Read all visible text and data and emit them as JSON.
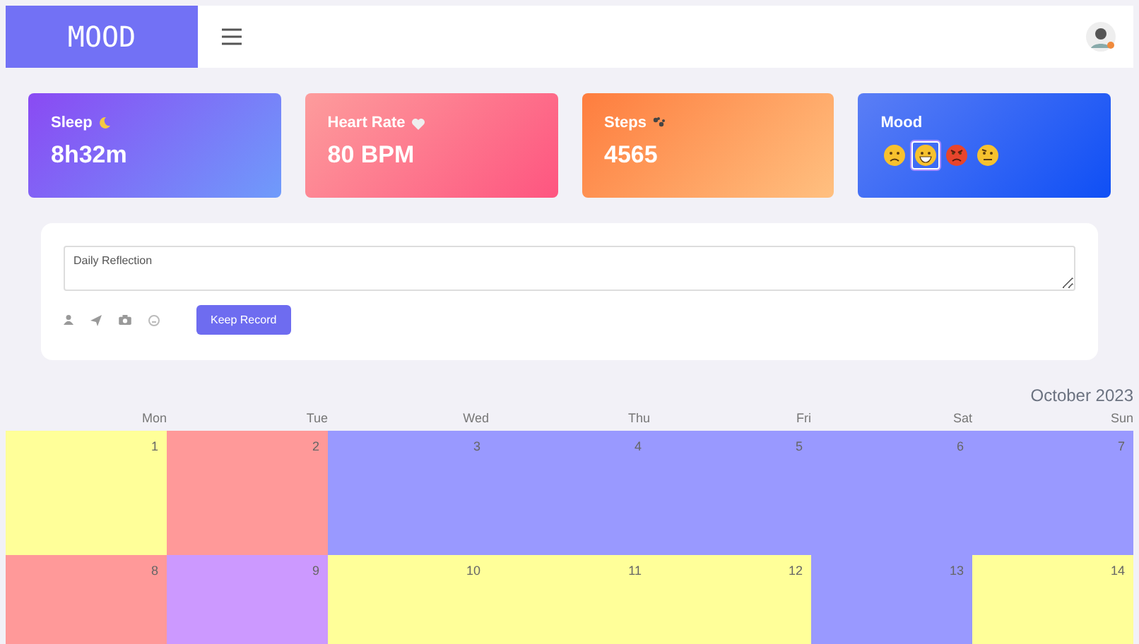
{
  "header": {
    "logo": "MOOD"
  },
  "stats": [
    {
      "kind": "sleep",
      "label": "Sleep",
      "value": "8h32m"
    },
    {
      "kind": "heart",
      "label": "Heart Rate",
      "value": "80 BPM"
    },
    {
      "kind": "steps",
      "label": "Steps",
      "value": "4565"
    }
  ],
  "mood": {
    "label": "Mood",
    "options": [
      {
        "kind": "sad",
        "selected": false
      },
      {
        "kind": "grin",
        "selected": true
      },
      {
        "kind": "angry",
        "selected": false
      },
      {
        "kind": "doubt",
        "selected": false
      }
    ]
  },
  "reflection": {
    "placeholder": "Daily Reflection",
    "button": "Keep Record"
  },
  "calendar": {
    "title": "October 2023",
    "weekdays": [
      "Mon",
      "Tue",
      "Wed",
      "Thu",
      "Fri",
      "Sat",
      "Sun"
    ],
    "days": [
      {
        "day": "1",
        "color": "#ffff99"
      },
      {
        "day": "2",
        "color": "#ff9999"
      },
      {
        "day": "3",
        "color": "#9999ff"
      },
      {
        "day": "4",
        "color": "#9999ff"
      },
      {
        "day": "5",
        "color": "#9999ff"
      },
      {
        "day": "6",
        "color": "#9999ff"
      },
      {
        "day": "7",
        "color": "#9999ff"
      },
      {
        "day": "8",
        "color": "#ff9999"
      },
      {
        "day": "9",
        "color": "#cc99ff"
      },
      {
        "day": "10",
        "color": "#ffff99"
      },
      {
        "day": "11",
        "color": "#ffff99"
      },
      {
        "day": "12",
        "color": "#ffff99"
      },
      {
        "day": "13",
        "color": "#9999ff"
      },
      {
        "day": "14",
        "color": "#ffff99"
      }
    ]
  }
}
